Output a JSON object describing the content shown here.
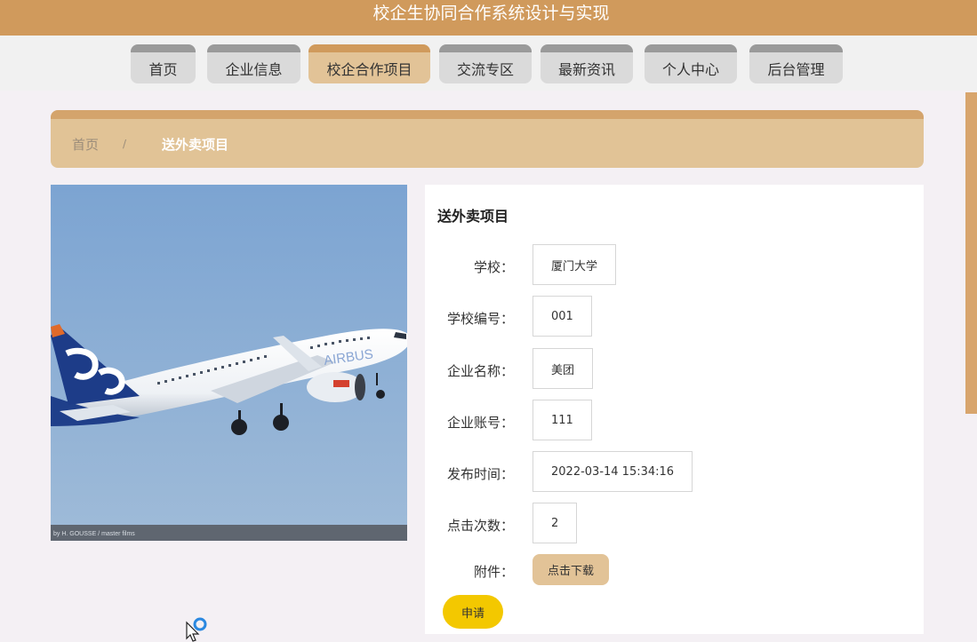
{
  "app": {
    "title": "校企生协同合作系统设计与实现"
  },
  "nav": {
    "items": [
      {
        "label": "首页"
      },
      {
        "label": "企业信息"
      },
      {
        "label": "校企合作项目"
      },
      {
        "label": "交流专区"
      },
      {
        "label": "最新资讯"
      },
      {
        "label": "个人中心"
      },
      {
        "label": "后台管理"
      }
    ],
    "active_index": 2
  },
  "breadcrumb": {
    "home": "首页",
    "separator": "/",
    "current": "送外卖项目"
  },
  "photo": {
    "credit": "by H. GOUSSE / master films",
    "livery_text": "AIRBUS"
  },
  "detail": {
    "title": "送外卖项目",
    "fields": [
      {
        "label": "学校：",
        "value": "厦门大学"
      },
      {
        "label": "学校编号：",
        "value": "001"
      },
      {
        "label": "企业名称：",
        "value": "美团"
      },
      {
        "label": "企业账号：",
        "value": "111"
      },
      {
        "label": "发布时间：",
        "value": "2022-03-14 15:34:16"
      },
      {
        "label": "点击次数：",
        "value": "2"
      }
    ],
    "attachment_label": "附件：",
    "download_label": "点击下载",
    "apply_label": "申请"
  },
  "colors": {
    "header": "#d09a5c",
    "nav_active": "#e2c397",
    "breadcrumb_bg": "#e1c396",
    "apply_button": "#f3c800"
  },
  "icons": {
    "cursor": "mouse-pointer-busy-icon"
  }
}
